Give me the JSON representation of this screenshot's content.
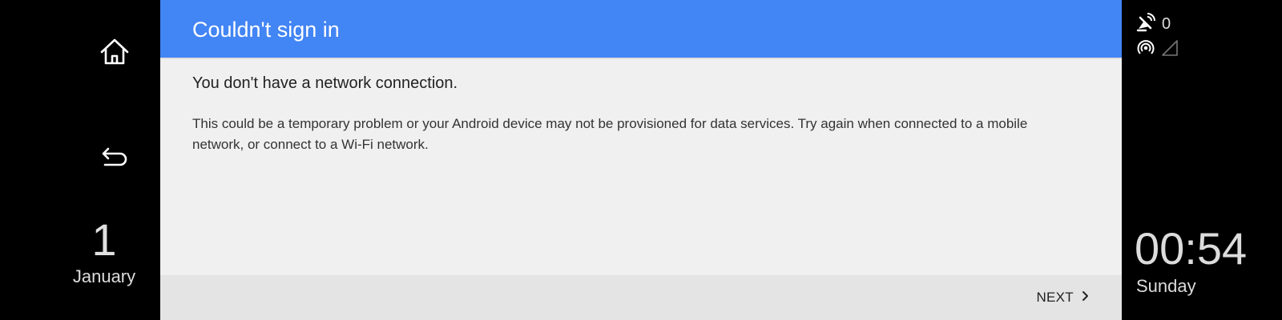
{
  "nav": {
    "home_icon": "home-icon",
    "back_icon": "back-icon"
  },
  "date": {
    "day": "1",
    "month": "January"
  },
  "dialog": {
    "title": "Couldn't sign in",
    "message": "You don't have a network connection.",
    "details": "This could be a temporary problem or your Android device may not be provisioned for data services. Try again when connected to a mobile network, or connect to a Wi-Fi network.",
    "next_label": "NEXT",
    "accent_color": "#4285f4"
  },
  "status": {
    "satellite_count": "0",
    "satellite_icon": "satellite-icon",
    "hotspot_icon": "hotspot-icon",
    "signal_icon": "cell-signal-icon"
  },
  "clock": {
    "time": "00:54",
    "weekday": "Sunday"
  }
}
